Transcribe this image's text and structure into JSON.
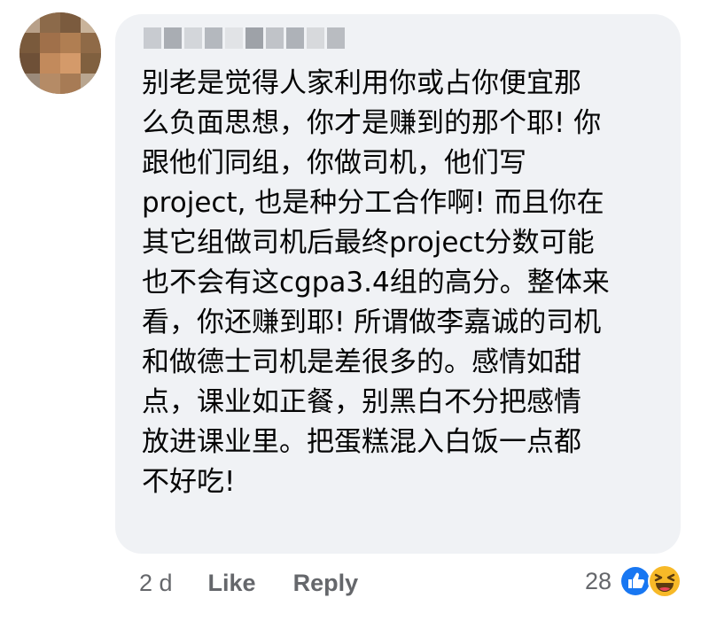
{
  "comment": {
    "author_name": "",
    "lines": [
      "别老是觉得人家利用你或占你便宜那",
      "么负面思想，你才是赚到的那个耶! 你",
      "跟他们同组，你做司机，他们写",
      "project, 也是种分工合作啊! 而且你在",
      "其它组做司机后最终project分数可能",
      "也不会有这cgpa3.4组的高分。整体来",
      "看，你还赚到耶! 所谓做李嘉诚的司机",
      "和做德士司机是差很多的。感情如甜",
      "点，课业如正餐，别黑白不分把感情",
      "放进课业里。把蛋糕混入白饭一点都",
      "不好吃!"
    ]
  },
  "actions": {
    "time": "2 d",
    "like_label": "Like",
    "reply_label": "Reply"
  },
  "reactions": {
    "count": "28",
    "icons": [
      "like-icon",
      "haha-icon"
    ]
  },
  "colors": {
    "bubble_bg": "#f0f2f5",
    "meta_text": "#65676b",
    "like_blue": "#1877f2",
    "haha_yellow": "#f7b928"
  }
}
